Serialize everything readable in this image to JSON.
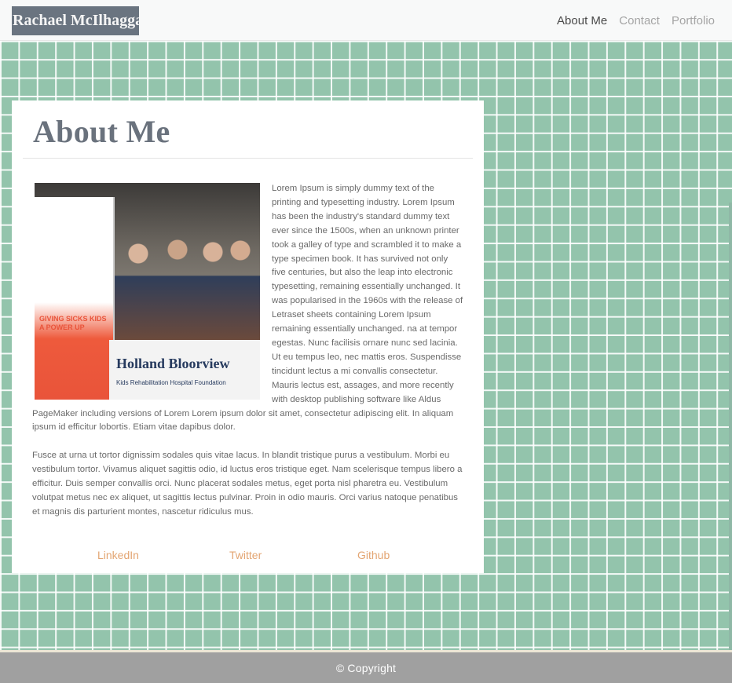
{
  "nav": {
    "brand": "Rachael McIlhagga",
    "links": [
      "About Me",
      "Contact",
      "Portfolio"
    ],
    "active": "About Me"
  },
  "about": {
    "title": "About Me",
    "photo_alt": "Team at Holland Bloorview booth",
    "photo_banner_text": "GIVING SICKS KIDS A POWER UP",
    "photo_table_text": "Holland Bloorview",
    "photo_table_sub": "Kids Rehabilitation Hospital Foundation",
    "paragraph1": "Lorem Ipsum is simply dummy text of the printing and typesetting industry. Lorem Ipsum has been the industry's standard dummy text ever since the 1500s, when an unknown printer took a galley of type and scrambled it to make a type specimen book. It has survived not only five centuries, but also the leap into electronic typesetting, remaining essentially unchanged. It was popularised in the 1960s with the release of Letraset sheets containing Lorem Ipsum remaining essentially unchanged. na at tempor egestas. Nunc facilisis ornare nunc sed lacinia. Ut eu tempus leo, nec mattis eros. Suspendisse tincidunt lectus a mi convallis consectetur. Mauris lectus est, assages, and more recently with desktop publishing software like Aldus PageMaker including versions of Lorem Lorem ipsum dolor sit amet, consectetur adipiscing elit. In aliquam ipsum id efficitur lobortis. Etiam vitae dapibus dolor.",
    "paragraph2": "Fusce at urna ut tortor dignissim sodales quis vitae lacus. In blandit tristique purus a vestibulum. Morbi eu vestibulum tortor. Vivamus aliquet sagittis odio, id luctus eros tristique eget. Nam scelerisque tempus libero a efficitur. Duis semper convallis orci. Nunc placerat sodales metus, eget porta nisl pharetra eu. Vestibulum volutpat metus nec ex aliquet, ut sagittis lectus pulvinar. Proin in odio mauris. Orci varius natoque penatibus et magnis dis parturient montes, nascetur ridiculus mus."
  },
  "social": {
    "linkedin": "LinkedIn",
    "twitter": "Twitter",
    "github": "Github"
  },
  "footer": {
    "copyright": "© Copyright"
  },
  "colors": {
    "background": "#93c4ac",
    "brand_bg": "#6a7480",
    "link_accent": "#e3a572",
    "footer_bg": "#a0a0a0"
  }
}
